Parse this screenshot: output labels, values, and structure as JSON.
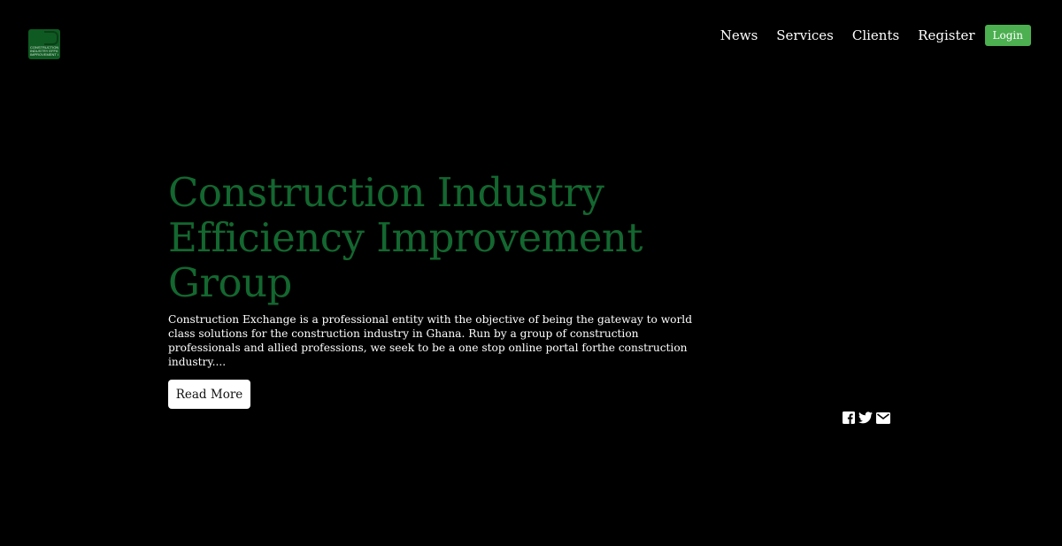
{
  "logo": {
    "lines": [
      "CONSTRUCTION",
      "INDUSTRY EFFICIENCY",
      "IMPROVEMENT GROUP"
    ]
  },
  "nav": {
    "items": [
      {
        "label": "News"
      },
      {
        "label": "Services"
      },
      {
        "label": "Clients"
      },
      {
        "label": "Register"
      }
    ],
    "login_label": "Login"
  },
  "hero": {
    "title_lines": [
      "Construction Industry",
      "Efficiency Improvement",
      "Group"
    ],
    "description": "Construction Exchange is a professional entity with the objective of being the gateway to world class solutions for the construction industry in Ghana. Run by a group of construction professionals and allied professions, we seek to be a one stop online portal forthe construction industry....",
    "read_more_label": "Read More"
  },
  "social": {
    "icons": [
      "facebook-icon",
      "twitter-icon",
      "email-icon"
    ]
  },
  "colors": {
    "background": "#000000",
    "title_green": "#13672f",
    "login_green": "#4caf50",
    "logo_green": "#0f5a22"
  }
}
